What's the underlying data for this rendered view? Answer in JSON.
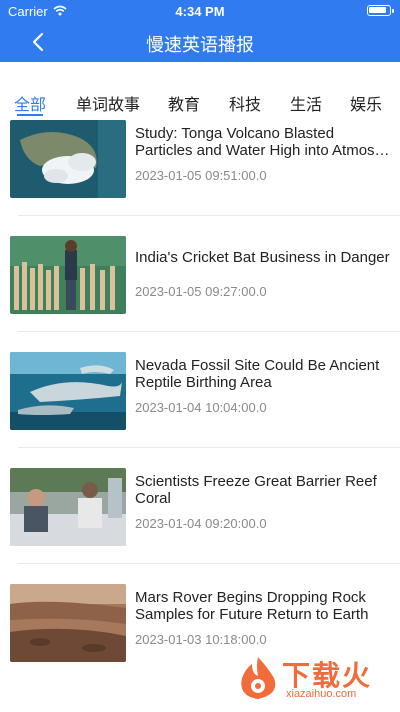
{
  "status_bar": {
    "carrier": "Carrier",
    "time": "4:34 PM",
    "battery_level": 0.9
  },
  "nav": {
    "title": "慢速英语播报",
    "back_icon": "chevron-left-icon"
  },
  "tabs": [
    {
      "label": "全部",
      "active": true
    },
    {
      "label": "单词故事",
      "active": false
    },
    {
      "label": "教育",
      "active": false
    },
    {
      "label": "科技",
      "active": false
    },
    {
      "label": "生活",
      "active": false
    },
    {
      "label": "娱乐",
      "active": false
    }
  ],
  "articles": [
    {
      "title": "Study: Tonga Volcano Blasted Particles and Water High into Atmos…",
      "date": "2023-01-05 09:51:00.0"
    },
    {
      "title": "India's Cricket Bat Business in Danger",
      "date": "2023-01-05 09:27:00.0"
    },
    {
      "title": "Nevada Fossil Site Could Be Ancient Reptile Birthing Area",
      "date": "2023-01-04 10:04:00.0"
    },
    {
      "title": "Scientists Freeze Great Barrier Reef Coral",
      "date": "2023-01-04 09:20:00.0"
    },
    {
      "title": "Mars Rover Begins Dropping Rock Samples for Future Return to Earth",
      "date": "2023-01-03 10:18:00.0"
    }
  ],
  "watermark": {
    "text": "下载火",
    "sub": "xiazaihuo.com"
  },
  "colors": {
    "accent": "#2f7bef",
    "date": "#8a8a8a",
    "watermark": "#f26b3a"
  }
}
